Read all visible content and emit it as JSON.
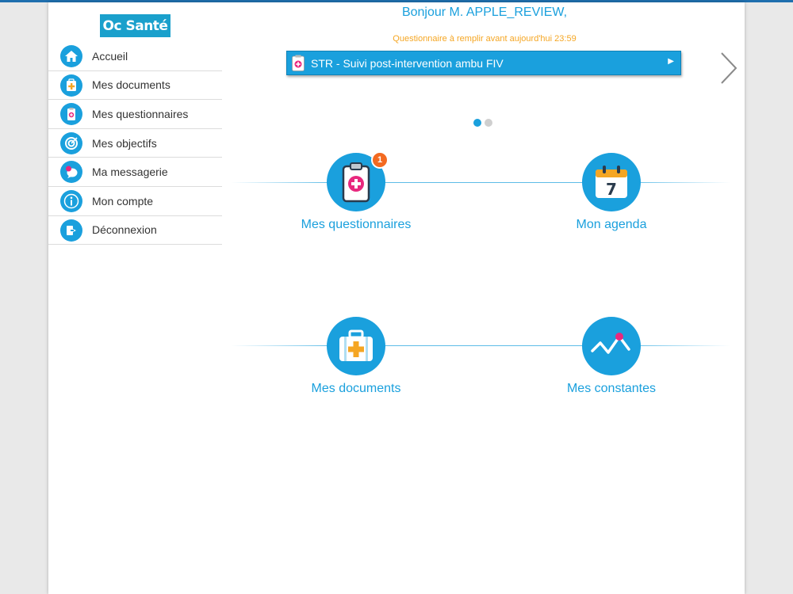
{
  "app": {
    "logo": "Oc Santé"
  },
  "sidebar": {
    "items": [
      {
        "label": "Accueil",
        "icon": "home-icon"
      },
      {
        "label": "Mes documents",
        "icon": "medical-kit-icon"
      },
      {
        "label": "Mes questionnaires",
        "icon": "clipboard-icon"
      },
      {
        "label": "Mes objectifs",
        "icon": "target-icon"
      },
      {
        "label": "Ma messagerie",
        "icon": "chat-bubble-icon"
      },
      {
        "label": "Mon compte",
        "icon": "info-icon"
      },
      {
        "label": "Déconnexion",
        "icon": "logout-icon"
      }
    ]
  },
  "header": {
    "greeting": "Bonjour M. APPLE_REVIEW,",
    "due_text": "Questionnaire à remplir avant aujourd'hui 23:59",
    "questionnaire_label": "STR - Suivi post-intervention ambu FIV"
  },
  "carousel": {
    "pages": 2,
    "active_page": 1
  },
  "tiles": [
    {
      "label": "Mes questionnaires",
      "icon": "clipboard-icon",
      "badge": "1"
    },
    {
      "label": "Mon agenda",
      "icon": "calendar-icon",
      "calendar_day": "7"
    },
    {
      "label": "Mes documents",
      "icon": "medical-kit-icon"
    },
    {
      "label": "Mes constantes",
      "icon": "vitals-chart-icon"
    }
  ],
  "colors": {
    "accent": "#1aa0dd",
    "due": "#f5a623",
    "badge": "#f36a21",
    "pink": "#e8287e",
    "calendar_top": "#f5a623"
  }
}
